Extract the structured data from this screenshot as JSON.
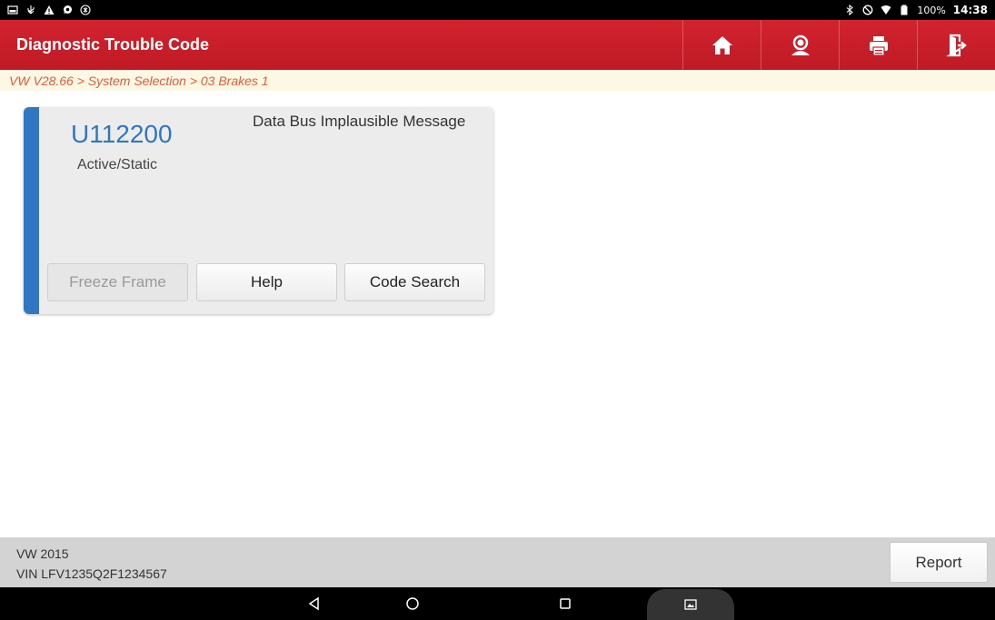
{
  "status_bar": {
    "left_icons": [
      "screenshot-icon",
      "usb-icon",
      "warning-icon",
      "chat-icon",
      "settings-circle-icon"
    ],
    "right_icons": [
      "bluetooth-icon",
      "no-disturb-icon",
      "wifi-icon",
      "battery-icon"
    ],
    "battery_percent": "100%",
    "time": "14:38"
  },
  "header": {
    "title": "Diagnostic Trouble Code",
    "buttons": [
      "home-icon",
      "user-support-icon",
      "print-icon",
      "exit-icon"
    ],
    "color": "#c8202b"
  },
  "breadcrumb": {
    "text": "VW V28.66 > System Selection > 03 Brakes 1"
  },
  "dtc": {
    "code": "U112200",
    "status": "Active/Static",
    "description": "Data Bus Implausible Message",
    "accent_color": "#2f77c3",
    "buttons": {
      "freeze_frame": "Freeze Frame",
      "help": "Help",
      "code_search": "Code Search"
    }
  },
  "vehicle": {
    "line1": "VW  2015",
    "line2": "VIN LFV1235Q2F1234567"
  },
  "footer": {
    "report_label": "Report"
  },
  "nav_bar": {
    "buttons": [
      "back-icon",
      "home-circle-icon",
      "recent-apps-icon",
      "gallery-icon"
    ]
  }
}
